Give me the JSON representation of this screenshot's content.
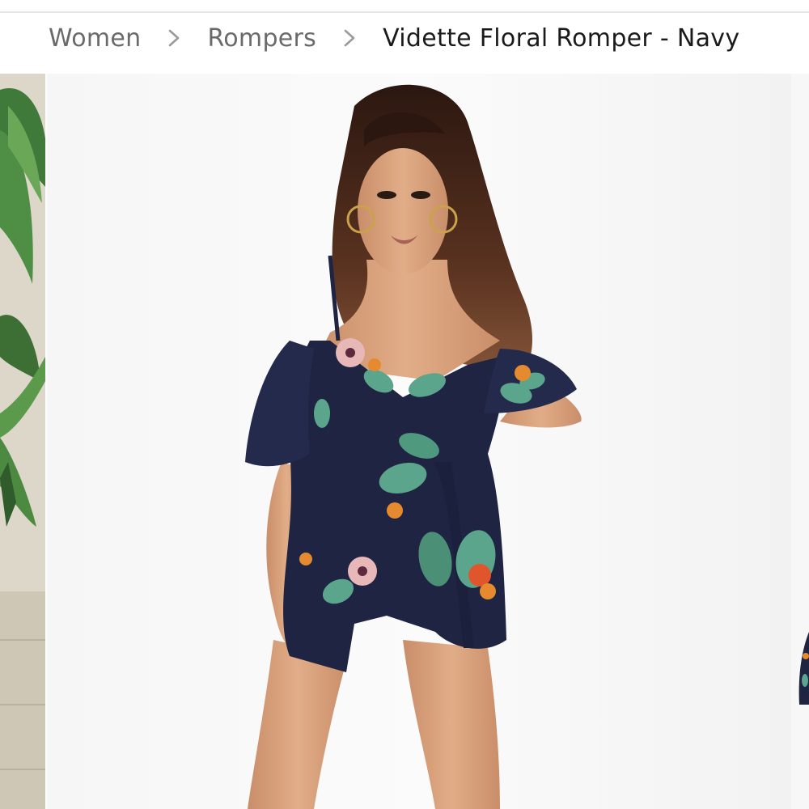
{
  "breadcrumb": {
    "items": [
      {
        "label": "Women"
      },
      {
        "label": "Rompers"
      }
    ],
    "current": "Vidette Floral Romper - Navy"
  },
  "product": {
    "name": "Vidette Floral Romper - Navy",
    "image_alt": "Model wearing a navy floral print cold-shoulder wrap romper"
  },
  "colors": {
    "navy": "#1f2442",
    "leaf_green": "#5aa58b",
    "flower_pink": "#e8b7b8",
    "flower_orange": "#e58a2f",
    "skin": "#d8a07a",
    "hair": "#4a2a1c",
    "backdrop": "#f7f7f7",
    "text_muted": "#6a6a6a",
    "text_dark": "#1a1a1a"
  },
  "icons": [
    "chevron-right-icon",
    "chevron-right-icon"
  ]
}
